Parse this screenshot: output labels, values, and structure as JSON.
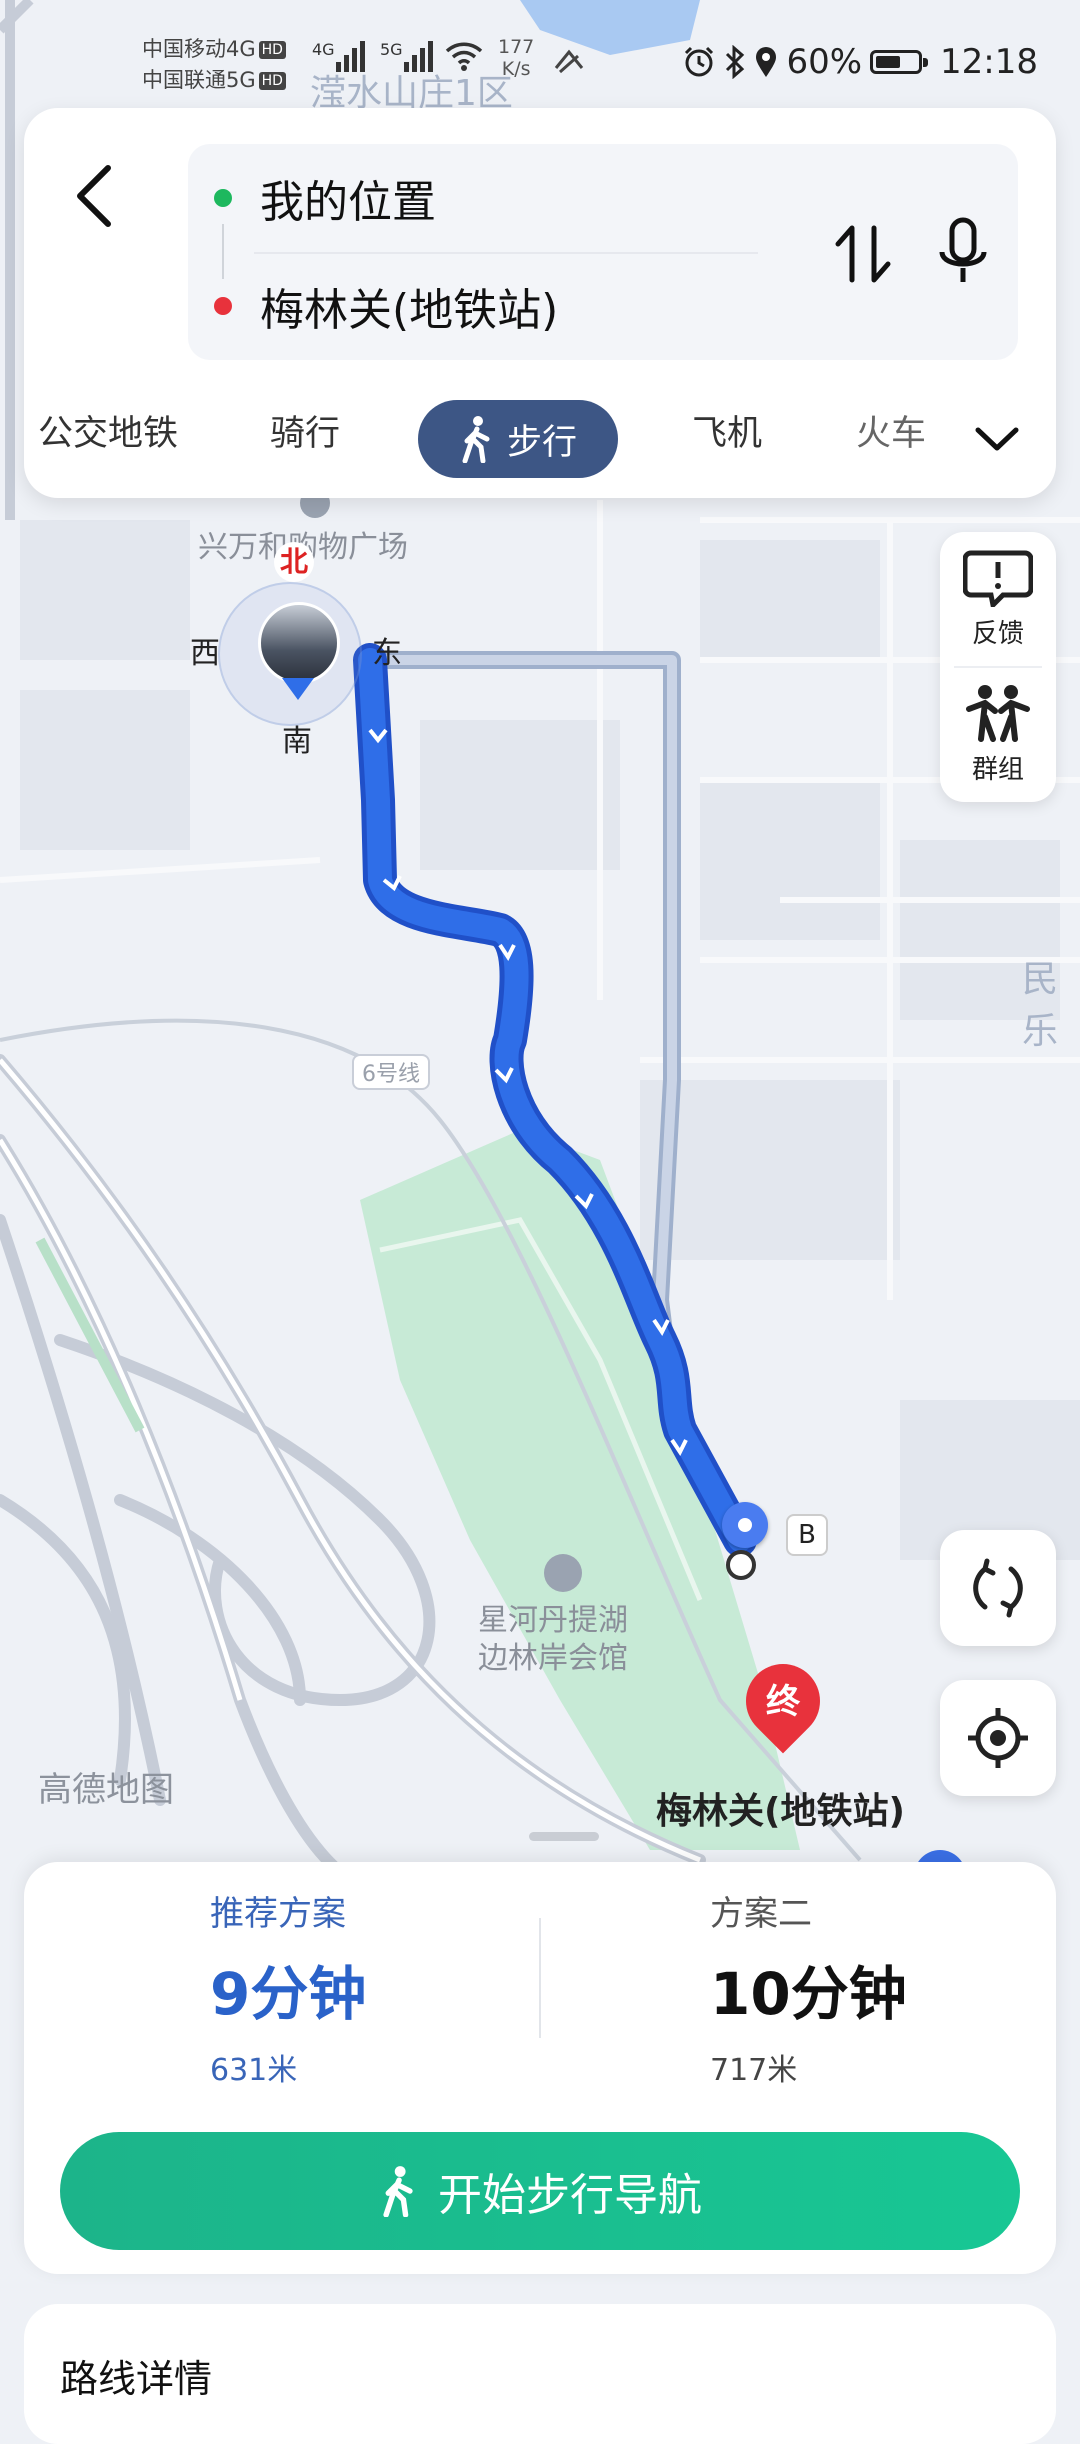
{
  "status_bar": {
    "carrier1": "中国移动4G",
    "carrier2": "中国联通5G",
    "hd1": "HD",
    "hd2": "HD",
    "sig1": "4G",
    "sig2": "5G",
    "net_speed_value": "177",
    "net_speed_unit": "K/s",
    "battery": "60%",
    "battery_level": 0.6,
    "time": "12:18"
  },
  "search": {
    "origin": "我的位置",
    "destination": "梅林关(地铁站)",
    "origin_color": "#1db85e",
    "destination_color": "#e8323c"
  },
  "tabs": [
    {
      "label": "公交地铁"
    },
    {
      "label": "骑行"
    },
    {
      "label": "步行",
      "active": true
    },
    {
      "label": "飞机"
    },
    {
      "label": "火车"
    }
  ],
  "side_panel": {
    "feedback": "反馈",
    "group": "群组"
  },
  "map": {
    "top_label": "滢水山庄1区",
    "mall": "兴万和购物广场",
    "compass": {
      "n": "北",
      "s": "南",
      "e": "东",
      "w": "西"
    },
    "line_label": "6号线",
    "park": "星河丹提湖边林岸会馆",
    "park_line1": "星河丹提湖",
    "park_line2": "边林岸会馆",
    "right_label": "民乐",
    "end_marker": "终",
    "waypoint": "B",
    "destination_label": "梅林关(地铁站)",
    "watermark": "高德地图",
    "route_color": "#2f6ee8"
  },
  "plans": [
    {
      "label": "推荐方案",
      "time": "9分钟",
      "distance": "631米"
    },
    {
      "label": "方案二",
      "time": "10分钟",
      "distance": "717米"
    }
  ],
  "start_button": "开始步行导航",
  "route_details": "路线详情"
}
